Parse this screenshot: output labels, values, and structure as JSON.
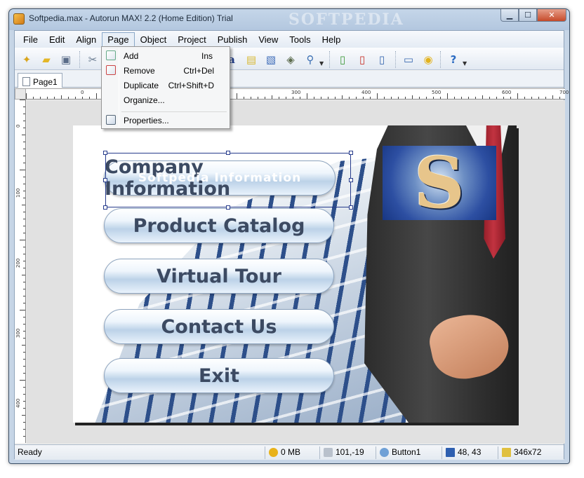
{
  "window": {
    "title": "Softpedia.max - Autorun MAX! 2.2 (Home Edition) Trial",
    "watermark": "SOFTPEDIA",
    "minimize_icon": "minimize-icon",
    "maximize_icon": "maximize-icon",
    "close_icon": "close-icon"
  },
  "menubar": {
    "items": [
      "File",
      "Edit",
      "Align",
      "Page",
      "Object",
      "Project",
      "Publish",
      "View",
      "Tools",
      "Help"
    ],
    "active": "Page"
  },
  "toolbar": {
    "icons": [
      "wand-icon",
      "open-folder-icon",
      "save-icon",
      "cut-icon",
      "text-tool-icon",
      "note-icon",
      "image-tool-icon",
      "video-tool-icon",
      "zoom-icon",
      "new-page-icon",
      "delete-page-icon",
      "preview-page-icon",
      "computer-icon",
      "cd-icon",
      "help-icon"
    ]
  },
  "tabs": [
    {
      "label": "Page1"
    }
  ],
  "ruler": {
    "h_labels": [
      "0",
      "300",
      "400",
      "500",
      "600",
      "700"
    ],
    "v_labels": [
      "0",
      "100",
      "200",
      "300",
      "400"
    ]
  },
  "page_menu": {
    "items": [
      {
        "label": "Add",
        "shortcut": "Ins",
        "icon": "add-page-icon"
      },
      {
        "label": "Remove",
        "shortcut": "Ctrl+Del",
        "icon": "remove-page-icon"
      },
      {
        "label": "Duplicate",
        "shortcut": "Ctrl+Shift+D",
        "icon": ""
      },
      {
        "label": "Organize...",
        "shortcut": "",
        "icon": ""
      },
      {
        "label": "Properties...",
        "shortcut": "",
        "icon": "properties-icon"
      }
    ]
  },
  "canvas": {
    "buttons": [
      "Company Information",
      "Product Catalog",
      "Virtual Tour",
      "Contact Us",
      "Exit"
    ],
    "overlay_text": "Softpedia Information",
    "logo_letter": "S"
  },
  "statusbar": {
    "status": "Ready",
    "memory": "0 MB",
    "cursor": "101,-19",
    "object": "Button1",
    "position": "48, 43",
    "size": "346x72"
  }
}
